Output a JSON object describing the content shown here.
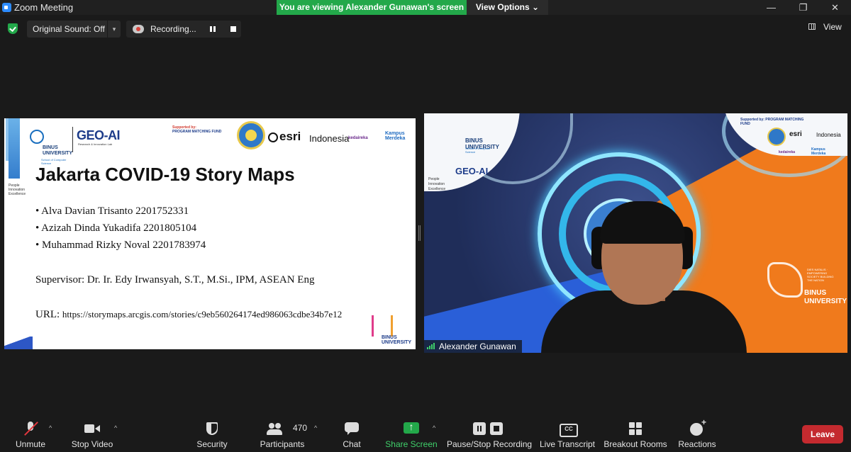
{
  "window": {
    "title": "Zoom Meeting",
    "viewing_banner": "You are viewing Alexander Gunawan's screen",
    "view_options": "View Options",
    "view_options_caret": "⌄",
    "minimize": "—",
    "restore": "❐",
    "close": "✕"
  },
  "topbar": {
    "original_sound": "Original Sound: Off",
    "original_sound_caret": "▾",
    "recording_label": "Recording...",
    "view_label": "View"
  },
  "slide": {
    "tagline": "People Innovation Excellence",
    "binus_name": "BINUS UNIVERSITY",
    "binus_sub": "School of Computer Science",
    "geoai": "GEO-AI",
    "geoai_sub": "Research & Innovation Lab",
    "supported_by": "Supported by:",
    "supported_fund": "PROGRAM MATCHING FUND",
    "esri": "esri",
    "indonesia": "Indonesia",
    "kedaireka": "kedaireka",
    "kampus": "Kampus Merdeka",
    "title": "Jakarta COVID-19 Story Maps",
    "members": [
      "• Alva Davian Trisanto 2201752331",
      "• Azizah Dinda Yukadifa 2201805104",
      "• Muhammad Rizky Noval 2201783974"
    ],
    "supervisor": "Supervisor: Dr. Ir. Edy Irwansyah, S.T., M.Si., IPM, ASEAN Eng",
    "url_label": "URL:",
    "url": "https://storymaps.arcgis.com/stories/c9eb560264174ed986063cdbe34b7e12",
    "badge_text": "BINUS UNIVERSITY"
  },
  "video": {
    "binus_name": "BINUS UNIVERSITY",
    "binus_sub": "School of Computer Science",
    "geoai": "GEO-AI",
    "tagline": "People Innovation Excellence",
    "supported": "Supported by: PROGRAM MATCHING FUND",
    "esri": "esri",
    "indonesia": "Indonesia",
    "kedaireka": "kedaireka",
    "kampus": "Kampus Merdeka",
    "badge_small": "DIES NATALIS · EMPOWERING SOCIETY BUILDING THE NATION",
    "badge_text": "BINUS UNIVERSITY",
    "participant_name": "Alexander Gunawan"
  },
  "toolbar": {
    "unmute": "Unmute",
    "stop_video": "Stop Video",
    "security": "Security",
    "participants": "Participants",
    "participants_count": "470",
    "chat": "Chat",
    "share_screen": "Share Screen",
    "pause_stop_recording": "Pause/Stop Recording",
    "live_transcript": "Live Transcript",
    "breakout_rooms": "Breakout Rooms",
    "reactions": "Reactions",
    "leave": "Leave",
    "caret": "^"
  },
  "colors": {
    "share_green": "#23a84a",
    "leave_red": "#c42a2f",
    "banner_green": "#23a84a",
    "orange_accent": "#f07a1c"
  },
  "icons": [
    "app-icon",
    "shield-icon",
    "record-icon",
    "pause-icon",
    "stop-icon",
    "grid-view-icon",
    "mic-muted-icon",
    "video-icon",
    "security-shield-icon",
    "participants-icon",
    "chat-icon",
    "share-screen-icon",
    "pause-stop-record-icon",
    "closed-caption-icon",
    "breakout-rooms-icon",
    "reactions-icon",
    "signal-bars-icon"
  ]
}
